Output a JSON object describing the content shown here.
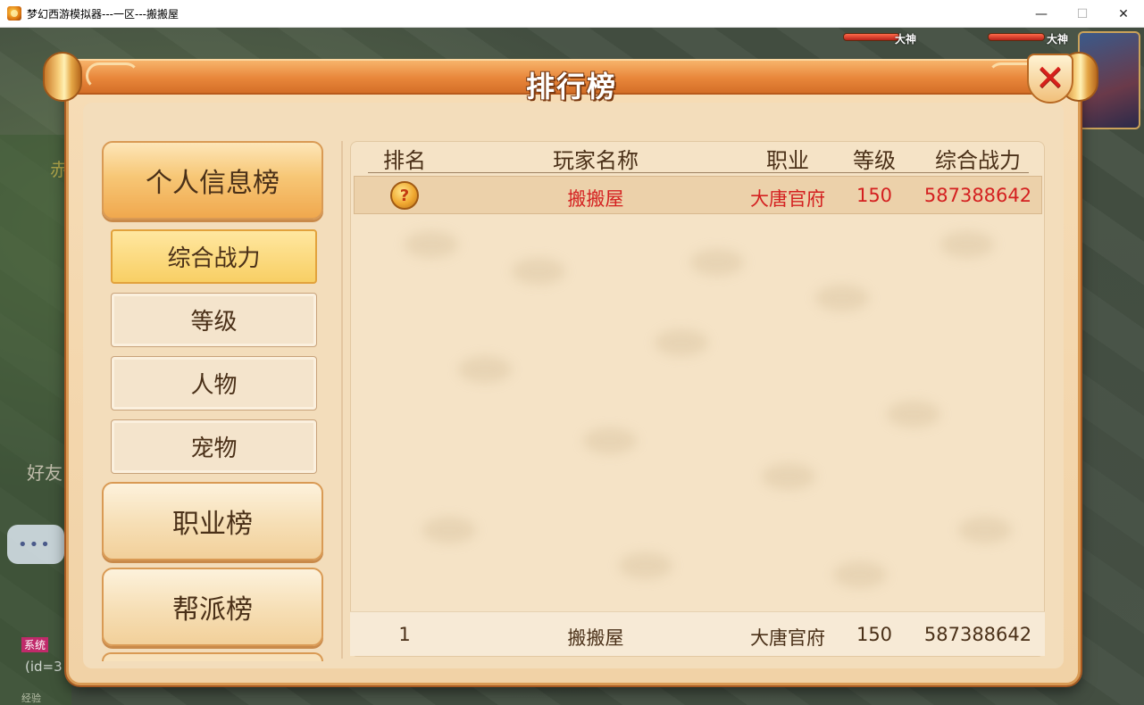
{
  "window": {
    "title": "梦幻西游模拟器---一区---搬搬屋",
    "minimize": "—",
    "maximize": "☐",
    "close": "✕"
  },
  "background": {
    "friend_label": "好友",
    "system_tag": "系统",
    "id_text": "(id=3",
    "exp_text": "经验",
    "side_char": "赤",
    "chat_dots": "•••",
    "top_labels": [
      "大神",
      "大神"
    ]
  },
  "dialog": {
    "title": "排行榜",
    "close_icon": "✕"
  },
  "nav": {
    "main": [
      {
        "label": "个人信息榜",
        "active": true
      },
      {
        "label": "职业榜",
        "active": false
      },
      {
        "label": "帮派榜",
        "active": false
      }
    ],
    "sub": [
      {
        "label": "综合战力",
        "active": true
      },
      {
        "label": "等级",
        "active": false
      },
      {
        "label": "人物",
        "active": false
      },
      {
        "label": "宠物",
        "active": false
      }
    ]
  },
  "table": {
    "columns": [
      "排名",
      "玩家名称",
      "职业",
      "等级",
      "综合战力"
    ],
    "rows": [
      {
        "rank_icon": "?",
        "name": "搬搬屋",
        "class": "大唐官府",
        "level": "150",
        "power": "587388642"
      }
    ],
    "self_row": {
      "rank": "1",
      "name": "搬搬屋",
      "class": "大唐官府",
      "level": "150",
      "power": "587388642"
    }
  },
  "colors": {
    "highlight_text": "#d42020",
    "normal_text": "#4a3018",
    "title_bar": "#e8863a"
  }
}
